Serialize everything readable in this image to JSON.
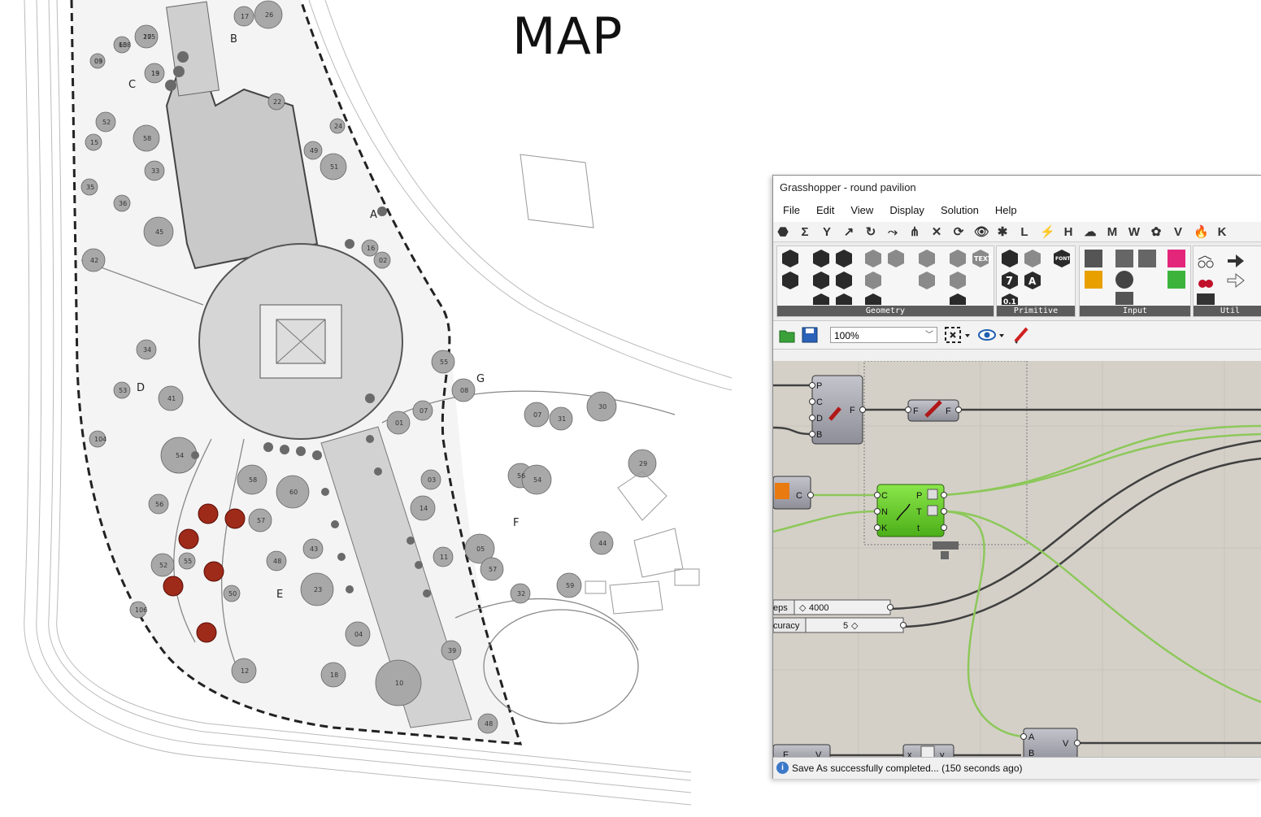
{
  "map": {
    "title": "MAP",
    "zone_labels": [
      "A",
      "B",
      "C",
      "D",
      "E",
      "F",
      "G"
    ],
    "tree_numbers": [
      "27",
      "65",
      "13",
      "03",
      "52",
      "58",
      "15",
      "33",
      "36",
      "45",
      "35",
      "42",
      "34",
      "41",
      "53",
      "54",
      "56",
      "55",
      "52",
      "50",
      "58",
      "60",
      "57",
      "48",
      "43",
      "23",
      "12",
      "18",
      "04",
      "10",
      "14",
      "11",
      "05",
      "57",
      "56",
      "54",
      "07",
      "31",
      "30",
      "29",
      "44",
      "59",
      "32",
      "39",
      "48",
      "51",
      "49",
      "22",
      "24",
      "17",
      "26",
      "55",
      "08",
      "07",
      "01",
      "03",
      "16",
      "02",
      "104",
      "106",
      "105",
      "108",
      "19",
      "09"
    ]
  },
  "window": {
    "title": "Grasshopper - round pavilion",
    "menus": [
      "File",
      "Edit",
      "View",
      "Display",
      "Solution",
      "Help"
    ],
    "tabs": [
      "⬣",
      "Σ",
      "Y",
      "↗",
      "↻",
      "⤳",
      "⋔",
      "✕",
      "⟳",
      "👁",
      "✱",
      "L",
      "⚡",
      "H",
      "☁",
      "M",
      "W",
      "✿",
      "V",
      "🔥",
      "K"
    ],
    "ribbon_panels": [
      "Geometry",
      "Primitive",
      "Input",
      "Util"
    ],
    "ribbon_number_label": "0.1",
    "ribbon_seven_label": "7",
    "ribbon_a_label": "A",
    "ribbon_text_label": "TEXT",
    "ribbon_font_label": "FONT",
    "zoom": "100%",
    "status": "Save As successfully completed... (150 seconds ago)",
    "status_icon": "i"
  },
  "canvas": {
    "comp_curve": {
      "inputs": [
        "P",
        "C",
        "D",
        "B"
      ],
      "output": "F"
    },
    "comp_ff": {
      "input": "F",
      "output": "F"
    },
    "comp_param_c": {
      "label": "C"
    },
    "comp_divide": {
      "inputs": [
        "C",
        "N",
        "K"
      ],
      "outputs": [
        "P",
        "T",
        "t"
      ]
    },
    "slider_steps": {
      "name": "eps",
      "value": "4000",
      "diamond": "◇"
    },
    "slider_accuracy": {
      "name": "curacy",
      "value": "5",
      "diamond": "◇"
    },
    "comp_bottom1": {
      "input": "F",
      "output": "V"
    },
    "comp_bottom2": {
      "input": "x",
      "output": "y"
    },
    "comp_bottom3": {
      "inputs": [
        "A",
        "B"
      ],
      "output": "V"
    }
  },
  "colors": {
    "canvas_bg": "#d4d0c8",
    "component_grey": "#9c9ca6",
    "component_green": "#6ad11f",
    "wire_dark": "#404040",
    "wire_green": "#8dc85a",
    "tree_red": "#9e2a1a",
    "tree_grey": "#a8a8a8",
    "path_grey": "#cfcfcf"
  }
}
